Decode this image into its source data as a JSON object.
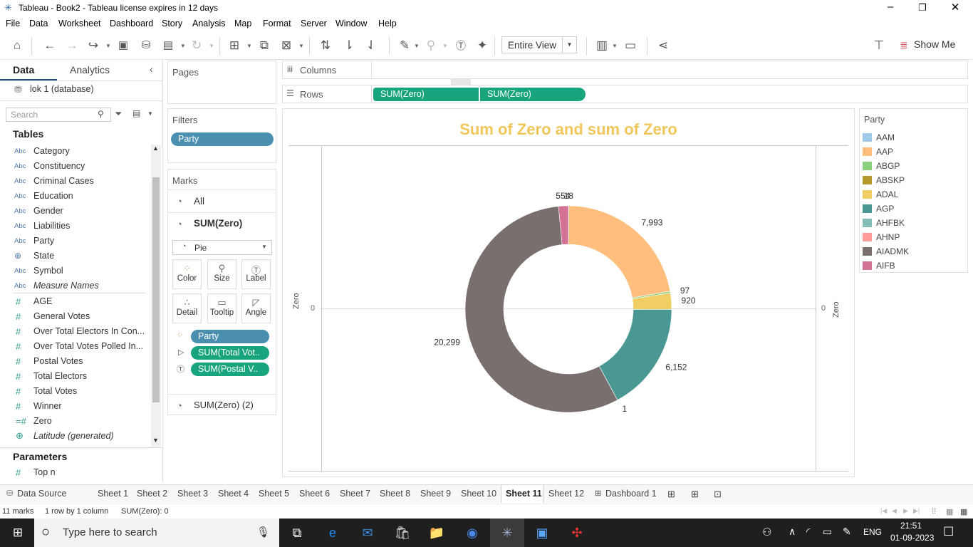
{
  "window": {
    "title": "Tableau - Book2 - Tableau license expires in 12 days"
  },
  "menu": [
    "File",
    "Data",
    "Worksheet",
    "Dashboard",
    "Story",
    "Analysis",
    "Map",
    "Format",
    "Server",
    "Window",
    "Help"
  ],
  "toolbar": {
    "fit_value": "Entire View",
    "show_me": "Show Me"
  },
  "data_pane": {
    "tab_data": "Data",
    "tab_analytics": "Analytics",
    "datasource": "lok 1 (database)",
    "search_placeholder": "Search",
    "tables_header": "Tables",
    "dimensions": [
      "Category",
      "Constituency",
      "Criminal Cases",
      "Education",
      "Gender",
      "Liabilities",
      "Party",
      "State",
      "Symbol",
      "Measure Names"
    ],
    "measures": [
      "AGE",
      "General Votes",
      "Over Total Electors  In Con...",
      "Over Total Votes Polled  In...",
      "Postal Votes",
      "Total Electors",
      "Total Votes",
      "Winner",
      "Zero",
      "Latitude (generated)"
    ],
    "parameters_header": "Parameters",
    "parameters": [
      "Top n"
    ]
  },
  "pages": {
    "label": "Pages"
  },
  "filters": {
    "label": "Filters",
    "pill": "Party"
  },
  "marks": {
    "label": "Marks",
    "all": "All",
    "current": "SUM(Zero)",
    "mark_type": "Pie",
    "buttons": [
      "Color",
      "Size",
      "Label",
      "Detail",
      "Tooltip",
      "Angle"
    ],
    "pills": [
      "Party",
      "SUM(Total Vot..",
      "SUM(Postal V.."
    ],
    "second": "SUM(Zero) (2)"
  },
  "shelves": {
    "columns_label": "Columns",
    "rows_label": "Rows",
    "rows_pills": [
      "SUM(Zero)",
      "SUM(Zero)"
    ]
  },
  "view": {
    "title": "Sum of Zero and sum of Zero",
    "axis_left_label": "Zero",
    "axis_right_label": "Zero",
    "axis_tick": "0"
  },
  "chart_data": {
    "type": "pie",
    "title": "Sum of Zero and sum of Zero",
    "slices": [
      {
        "label": "AAM",
        "value": 18,
        "color": "#a0cbe8"
      },
      {
        "label": "AAP",
        "value": 7993,
        "color": "#ffbe7d"
      },
      {
        "label": "ABGP",
        "value": 97,
        "color": "#8cd17d"
      },
      {
        "label": "ABSKP",
        "value": 0,
        "color": "#b6992d"
      },
      {
        "label": "ADAL",
        "value": 920,
        "color": "#f1ce63"
      },
      {
        "label": "AGP",
        "value": 6152,
        "color": "#499894"
      },
      {
        "label": "AHFBK",
        "value": 0,
        "color": "#86bcb6"
      },
      {
        "label": "AHNP",
        "value": 1,
        "color": "#ff9d9a"
      },
      {
        "label": "AIADMK",
        "value": 20299,
        "color": "#79706e"
      },
      {
        "label": "AIFB",
        "value": 554,
        "color": "#d37295"
      }
    ]
  },
  "legend": {
    "title": "Party"
  },
  "sheet_tabs": [
    "Data Source",
    "Sheet 1",
    "Sheet 2",
    "Sheet 3",
    "Sheet 4",
    "Sheet 5",
    "Sheet 6",
    "Sheet 7",
    "Sheet 8",
    "Sheet 9",
    "Sheet 10",
    "Sheet 11",
    "Sheet 12",
    "Dashboard 1"
  ],
  "status": {
    "marks": "11 marks",
    "rowscols": "1 row by 1 column",
    "sum": "SUM(Zero): 0"
  },
  "taskbar": {
    "search_placeholder": "Type here to search",
    "lang": "ENG",
    "time": "21:51",
    "date": "01-09-2023"
  }
}
